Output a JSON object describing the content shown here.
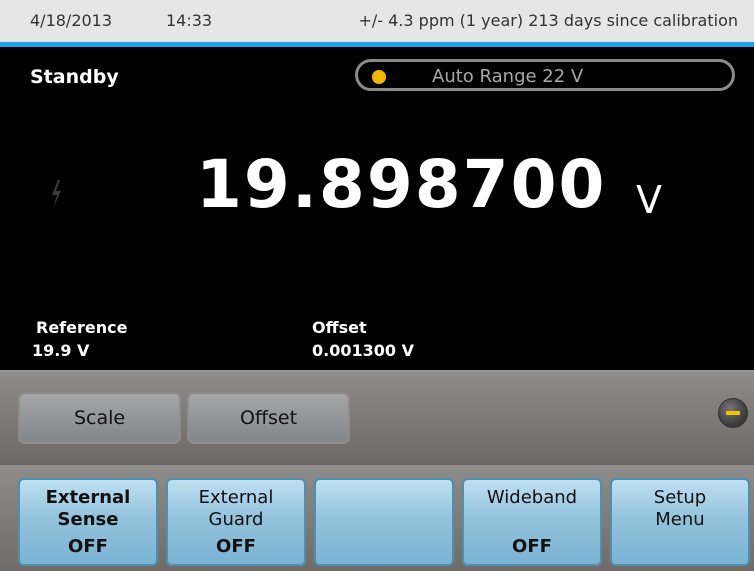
{
  "status_bar": {
    "date": "4/18/2013",
    "time": "14:33",
    "calibration": "+/- 4.3 ppm (1 year)  213 days since calibration"
  },
  "display": {
    "state": "Standby",
    "range": "Auto Range 22 V",
    "reading": "19.898700",
    "unit": "V",
    "reference_label": "Reference",
    "reference_value": "19.9 V",
    "offset_label": "Offset",
    "offset_value": "0.001300 V"
  },
  "function_keys": {
    "scale": "Scale",
    "offset": "Offset"
  },
  "softkeys": [
    {
      "line1": "External",
      "line2": "Sense",
      "state": "OFF"
    },
    {
      "line1": "External",
      "line2": "Guard",
      "state": "OFF"
    },
    {
      "line1": "",
      "line2": "",
      "state": ""
    },
    {
      "line1": "Wideband",
      "line2": "",
      "state": "OFF"
    },
    {
      "line1": "Setup",
      "line2": "Menu",
      "state": ""
    }
  ],
  "colors": {
    "accent_line": "#1ea0e6",
    "range_indicator": "#f5b800",
    "softkey_blue": "#93c3dc"
  }
}
